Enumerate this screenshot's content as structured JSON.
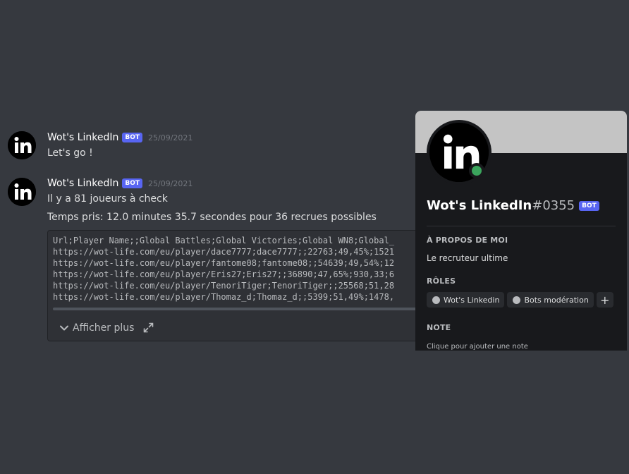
{
  "messages": [
    {
      "username": "Wot's LinkedIn",
      "bot_tag": "BOT",
      "timestamp": "25/09/2021",
      "lines": [
        "Let's go !"
      ]
    },
    {
      "username": "Wot's LinkedIn",
      "bot_tag": "BOT",
      "timestamp": "25/09/2021",
      "lines": [
        "Il y a 81 joueurs à check",
        "Temps pris: 12.0 minutes 35.7 secondes pour 36 recrues possibles"
      ]
    }
  ],
  "codeblock": {
    "lines": [
      "Url;Player Name;;Global Battles;Global Victories;Global WN8;Global_",
      "https://wot-life.com/eu/player/dace7777;dace7777;;22763;49,45%;1521",
      "https://wot-life.com/eu/player/fantome08;fantome08;;54639;49,54%;12",
      "https://wot-life.com/eu/player/Eris27;Eris27;;36890;47,65%;930,33;6",
      "https://wot-life.com/eu/player/TenoriTiger;TenoriTiger;;25568;51,28",
      "https://wot-life.com/eu/player/Thomaz_d;Thomaz_d;;5399;51,49%;1478,"
    ],
    "expand_label": "Afficher plus"
  },
  "profile": {
    "name": "Wot's LinkedIn",
    "discriminator": "#0355",
    "bot_tag": "BOT",
    "about_title": "À PROPOS DE MOI",
    "about_text": "Le recruteur ultime",
    "roles_title": "RÔLES",
    "roles": [
      "Wot's Linkedin",
      "Bots modération"
    ],
    "add_role": "+",
    "note_title": "NOTE",
    "note_placeholder": "Clique pour ajouter une note"
  },
  "colors": {
    "background": "#36393f",
    "bot_tag": "#5865f2",
    "status_online": "#3ba55d",
    "banner": "#c4c4c4"
  }
}
